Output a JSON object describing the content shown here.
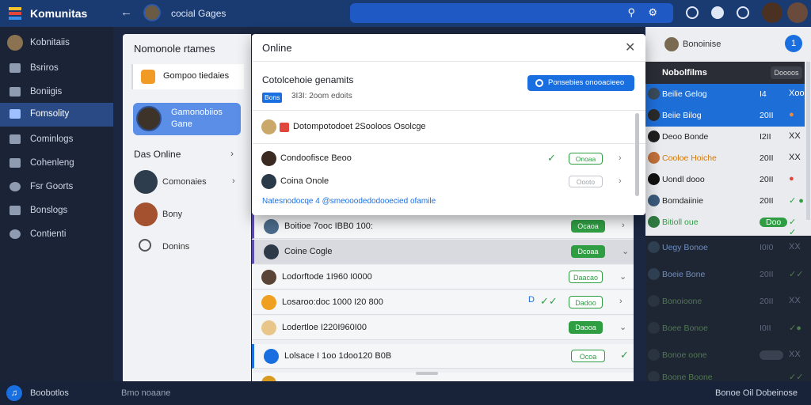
{
  "topbar": {
    "brand": "Komunitas",
    "back_icon": "arrow-left-icon",
    "group_name": "cocial Gages",
    "search_icons": [
      "search-icon",
      "settings-icon"
    ],
    "right_icons": [
      "smile-icon",
      "chat-icon",
      "help-icon"
    ]
  },
  "sidebar": {
    "items": [
      {
        "label": "Kobnitaiis",
        "icon": "avatar"
      },
      {
        "label": "Bsriros",
        "icon": "chart-icon"
      },
      {
        "label": "Boniigis",
        "icon": "user-icon"
      },
      {
        "label": "Fomsolity",
        "icon": "community-icon",
        "active": true
      },
      {
        "label": "Cominlogs",
        "icon": "list-icon"
      },
      {
        "label": "Cohenleng",
        "icon": "grid-icon"
      },
      {
        "label": "Fsr Goorts",
        "icon": "globe-icon"
      },
      {
        "label": "Bonslogs",
        "icon": "video-icon"
      },
      {
        "label": "Contienti",
        "icon": "gear-icon"
      }
    ]
  },
  "midpanel": {
    "title": "Nomonole rtames",
    "card_label": "Gompoo tiedaies",
    "selected": {
      "line1": "Gamonobiios",
      "line2": "Gane"
    },
    "section": "Das Online",
    "rows": [
      {
        "label": "Comonaies",
        "icon": "avatar"
      },
      {
        "label": "Bony",
        "icon": "avatar"
      },
      {
        "label": "Donins",
        "icon": "user-icon"
      }
    ]
  },
  "modal": {
    "title": "Online",
    "close_icon": "close-icon",
    "group_title": "Cotolcehoie genamits",
    "badge": "Bons",
    "sub": "3I3I: 2oom edoits",
    "cta": "Ponsebies onooacieeo",
    "header_row": "Dotompotodoet 2Sooloos Osolcge",
    "rows": [
      {
        "label": "Condoofisce Beoo",
        "pill": "Onoaa",
        "pill_style": "g",
        "check": true
      },
      {
        "label": "Coina Onole",
        "pill": "Oooto",
        "pill_style": "gray",
        "check": false
      }
    ],
    "link": "Natesnodocqe 4 @smeooodedodooecied ofamile"
  },
  "mainlist": {
    "rows": [
      {
        "label": "Boitioe 7ooc IBB0 100:",
        "pill": "Ocaoa",
        "pill_style": "fill",
        "mark": "purple",
        "hl": false,
        "ck": "none"
      },
      {
        "label": "Coine Cogle",
        "pill": "Dcoaa",
        "pill_style": "fill",
        "mark": "purple",
        "hl": true,
        "ck": "none"
      },
      {
        "label": "Lodorftode 1I960 I0000",
        "pill": "Daacao",
        "pill_style": "out",
        "mark": "",
        "hl": false,
        "ck": "none"
      },
      {
        "label": "Losaroo:doc 1000 I20 800",
        "pill": "Dadoo",
        "pill_style": "out",
        "mark": "",
        "hl": false,
        "ck": "double"
      },
      {
        "label": "Lodertloe I220I960I00",
        "pill": "Daooa",
        "pill_style": "fill",
        "mark": "",
        "hl": false,
        "ck": "none"
      },
      {
        "label": "Lolsace I 1oo 1doo120 B0B",
        "pill": "Ocoa",
        "pill_style": "out",
        "mark": "blue",
        "hl": false,
        "ck": "end"
      }
    ]
  },
  "rightpanel": {
    "search_label": "Bonoinise",
    "search_btn": "1",
    "head_label": "Nobolfilms",
    "head_tag": "Doooos",
    "rows": [
      {
        "name": "Beilie Gelog",
        "value": "I4",
        "x": "Xoo",
        "style": "blue"
      },
      {
        "name": "Beiie Bilog",
        "value": "20II",
        "x": "●",
        "style": "blue"
      },
      {
        "name": "Deoo Bonde",
        "value": "I2II",
        "x": "XX",
        "style": ""
      },
      {
        "name": "Cooloe Hoiche",
        "value": "20II",
        "x": "XX",
        "style": "orange"
      },
      {
        "name": "Uondl dooo",
        "value": "20II",
        "x": "●",
        "style": ""
      },
      {
        "name": "Bomdaiinie",
        "value": "20II",
        "x": "✓ ●",
        "style": ""
      },
      {
        "name": "Bitioll oue",
        "value": "Doo",
        "x": "✓ ✓",
        "style": "green"
      }
    ],
    "dim_rows": [
      {
        "name": "Uegy Bonoe",
        "value": "I0I0",
        "x": "XX"
      },
      {
        "name": "Boeie Bone",
        "value": "20II",
        "x": "✓✓"
      },
      {
        "name": "Bonoioone",
        "value": "20II",
        "x": "XX"
      },
      {
        "name": "Boee Bonoe",
        "value": "I0II",
        "x": "✓●"
      },
      {
        "name": "Bonoe oone",
        "value": "",
        "x": "XX"
      },
      {
        "name": "Boone Boone",
        "value": "",
        "x": "✓✓"
      }
    ]
  },
  "bottombar": {
    "left_label": "Boobotlos",
    "mid_label": "Bmo noaane",
    "right_label": "Bonoe Oil Dobeinose"
  },
  "colors": {
    "accent": "#1a6fe0",
    "success": "#2f9e43",
    "dark": "#1b2436"
  }
}
